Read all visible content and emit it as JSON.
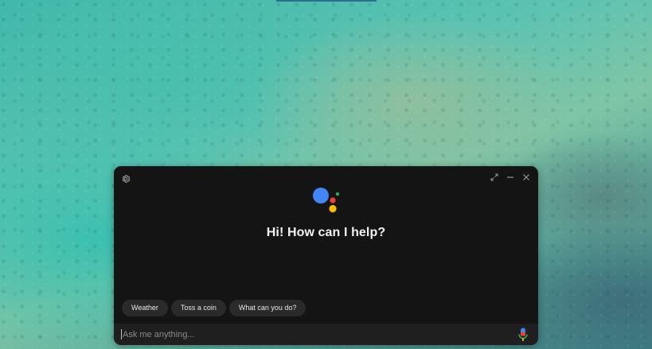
{
  "assistant": {
    "greeting": "Hi! How can I help?",
    "icons": {
      "settings": "gear-icon",
      "expand": "expand-icon",
      "minimize": "minimize-icon",
      "close": "close-icon",
      "logo": "google-assistant-logo",
      "mic": "microphone-icon"
    },
    "logo_colors": {
      "blue": "#4285F4",
      "red": "#EA4335",
      "yellow": "#FBBC05",
      "green": "#34A853"
    },
    "suggestions": [
      {
        "label": "Weather"
      },
      {
        "label": "Toss a coin"
      },
      {
        "label": "What can you do?"
      }
    ],
    "input": {
      "value": "",
      "placeholder": "Ask me anything..."
    }
  }
}
